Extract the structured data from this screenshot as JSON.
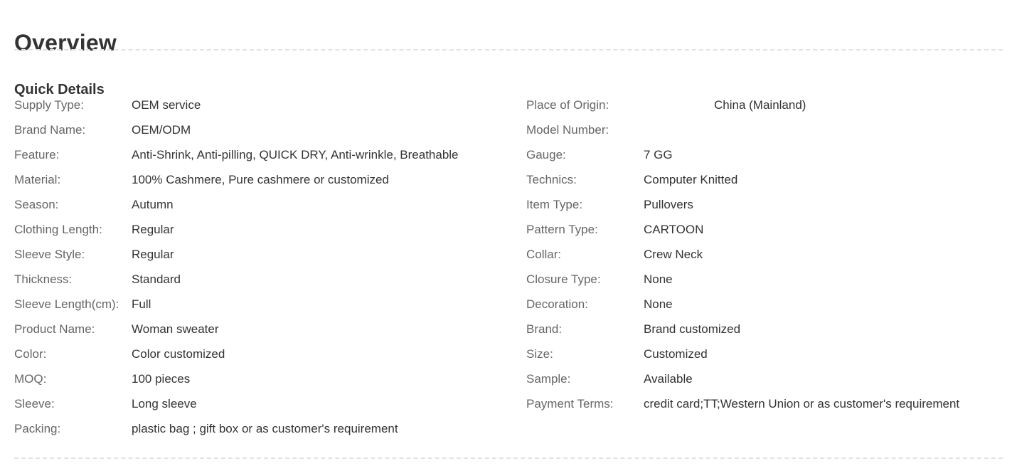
{
  "page_title": "Overview",
  "section_title": "Quick Details",
  "left_details": [
    {
      "label": "Supply Type:",
      "value": "OEM service"
    },
    {
      "label": "Brand Name:",
      "value": "OEM/ODM"
    },
    {
      "label": "Feature:",
      "value": "Anti-Shrink, Anti-pilling, QUICK DRY, Anti-wrinkle, Breathable"
    },
    {
      "label": "Material:",
      "value": "100% Cashmere, Pure cashmere or customized"
    },
    {
      "label": "Season:",
      "value": "Autumn"
    },
    {
      "label": "Clothing Length:",
      "value": "Regular"
    },
    {
      "label": "Sleeve Style:",
      "value": "Regular"
    },
    {
      "label": "Thickness:",
      "value": "Standard"
    },
    {
      "label": "Sleeve Length(cm):",
      "value": "Full"
    },
    {
      "label": "Product Name:",
      "value": "Woman sweater"
    },
    {
      "label": "Color:",
      "value": "Color customized"
    },
    {
      "label": "MOQ:",
      "value": "100 pieces"
    },
    {
      "label": "Sleeve:",
      "value": "Long sleeve"
    },
    {
      "label": "Packing:",
      "value": "plastic bag ; gift box or as customer's requirement"
    }
  ],
  "right_details": [
    {
      "label": "Place of Origin:",
      "value": "China (Mainland)"
    },
    {
      "label": "Model Number:",
      "value": ""
    },
    {
      "label": "Gauge:",
      "value": "7 GG"
    },
    {
      "label": "Technics:",
      "value": "Computer Knitted"
    },
    {
      "label": "Item Type:",
      "value": "Pullovers"
    },
    {
      "label": "Pattern Type:",
      "value": "CARTOON"
    },
    {
      "label": "Collar:",
      "value": "Crew Neck"
    },
    {
      "label": "Closure Type:",
      "value": "None"
    },
    {
      "label": "Decoration:",
      "value": "None"
    },
    {
      "label": "Brand:",
      "value": "Brand customized"
    },
    {
      "label": "Size:",
      "value": "Customized"
    },
    {
      "label": "Sample:",
      "value": "Available"
    },
    {
      "label": "Payment Terms:",
      "value": "credit card;TT;Western Union or as customer's requirement"
    }
  ]
}
